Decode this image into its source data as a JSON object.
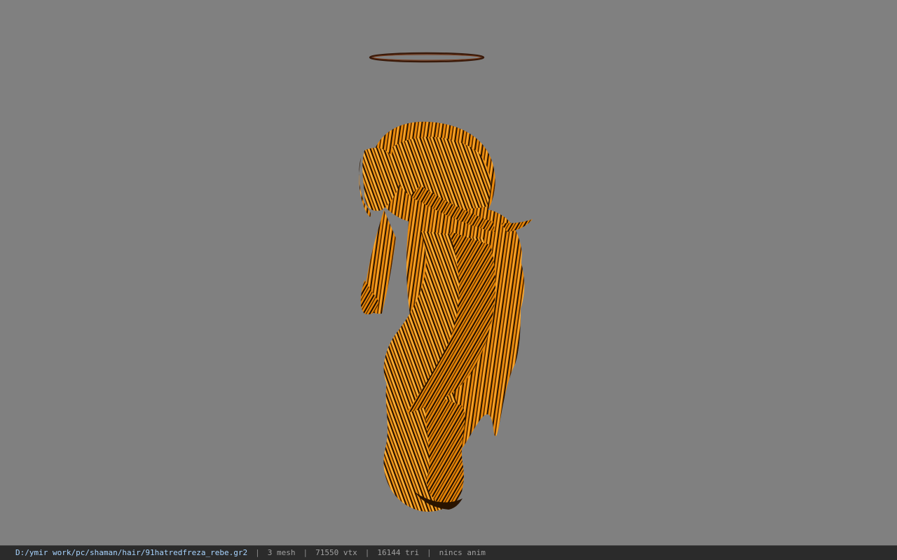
{
  "app": {
    "background_color": "#808080"
  },
  "model": {
    "hair_color": "#e8890c",
    "hair_dark": "#2a1400",
    "halo_color": "#3a1a0a"
  },
  "statusbar": {
    "file_path": "D:/ymir work/pc/shaman/hair/91hatredfreza_rebe.gr2",
    "separator": "|",
    "mesh_count": "3 mesh",
    "vertex_count": "71550 vtx",
    "triangle_count": "16144 tri",
    "anim_info": "nincs anim"
  }
}
